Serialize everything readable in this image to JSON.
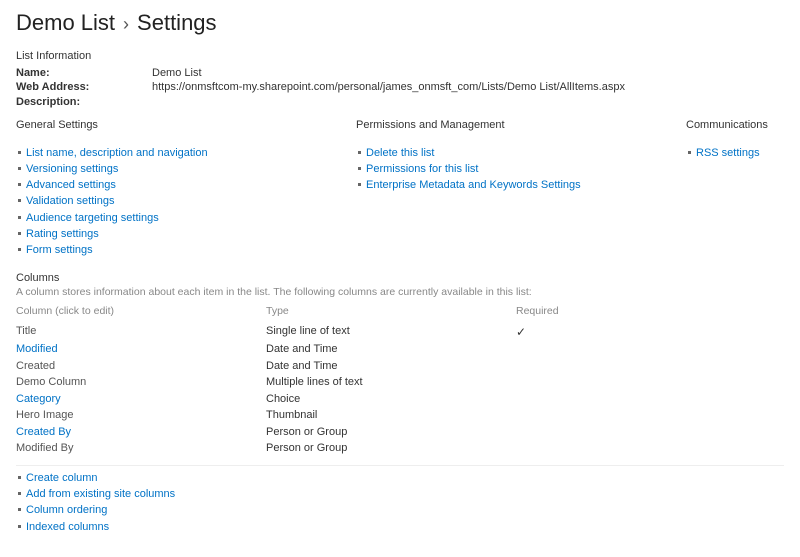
{
  "header": {
    "list_title": "Demo List",
    "page_title": "Settings",
    "sep": "›"
  },
  "list_info": {
    "heading": "List Information",
    "rows": [
      {
        "label": "Name:",
        "value": "Demo List"
      },
      {
        "label": "Web Address:",
        "value": "https://onmsftcom-my.sharepoint.com/personal/james_onmsft_com/Lists/Demo List/AllItems.aspx"
      },
      {
        "label": "Description:",
        "value": ""
      }
    ]
  },
  "settings": {
    "general": {
      "heading": "General Settings",
      "items": [
        "List name, description and navigation",
        "Versioning settings",
        "Advanced settings",
        "Validation settings",
        "Audience targeting settings",
        "Rating settings",
        "Form settings"
      ]
    },
    "permissions": {
      "heading": "Permissions and Management",
      "items": [
        "Delete this list",
        "Permissions for this list",
        "Enterprise Metadata and Keywords Settings"
      ]
    },
    "communications": {
      "heading": "Communications",
      "items": [
        "RSS settings"
      ]
    }
  },
  "columns": {
    "heading": "Columns",
    "description": "A column stores information about each item in the list. The following columns are currently available in this list:",
    "table_headers": {
      "name": "Column (click to edit)",
      "type": "Type",
      "required": "Required"
    },
    "rows": [
      {
        "name": "Title",
        "type": "Single line of text",
        "required": true,
        "link": false
      },
      {
        "name": "Modified",
        "type": "Date and Time",
        "required": false,
        "link": true
      },
      {
        "name": "Created",
        "type": "Date and Time",
        "required": false,
        "link": false
      },
      {
        "name": "Demo Column",
        "type": "Multiple lines of text",
        "required": false,
        "link": false
      },
      {
        "name": "Category",
        "type": "Choice",
        "required": false,
        "link": true
      },
      {
        "name": "Hero Image",
        "type": "Thumbnail",
        "required": false,
        "link": false
      },
      {
        "name": "Created By",
        "type": "Person or Group",
        "required": false,
        "link": true
      },
      {
        "name": "Modified By",
        "type": "Person or Group",
        "required": false,
        "link": false
      }
    ],
    "actions": [
      "Create column",
      "Add from existing site columns",
      "Column ordering",
      "Indexed columns"
    ]
  }
}
